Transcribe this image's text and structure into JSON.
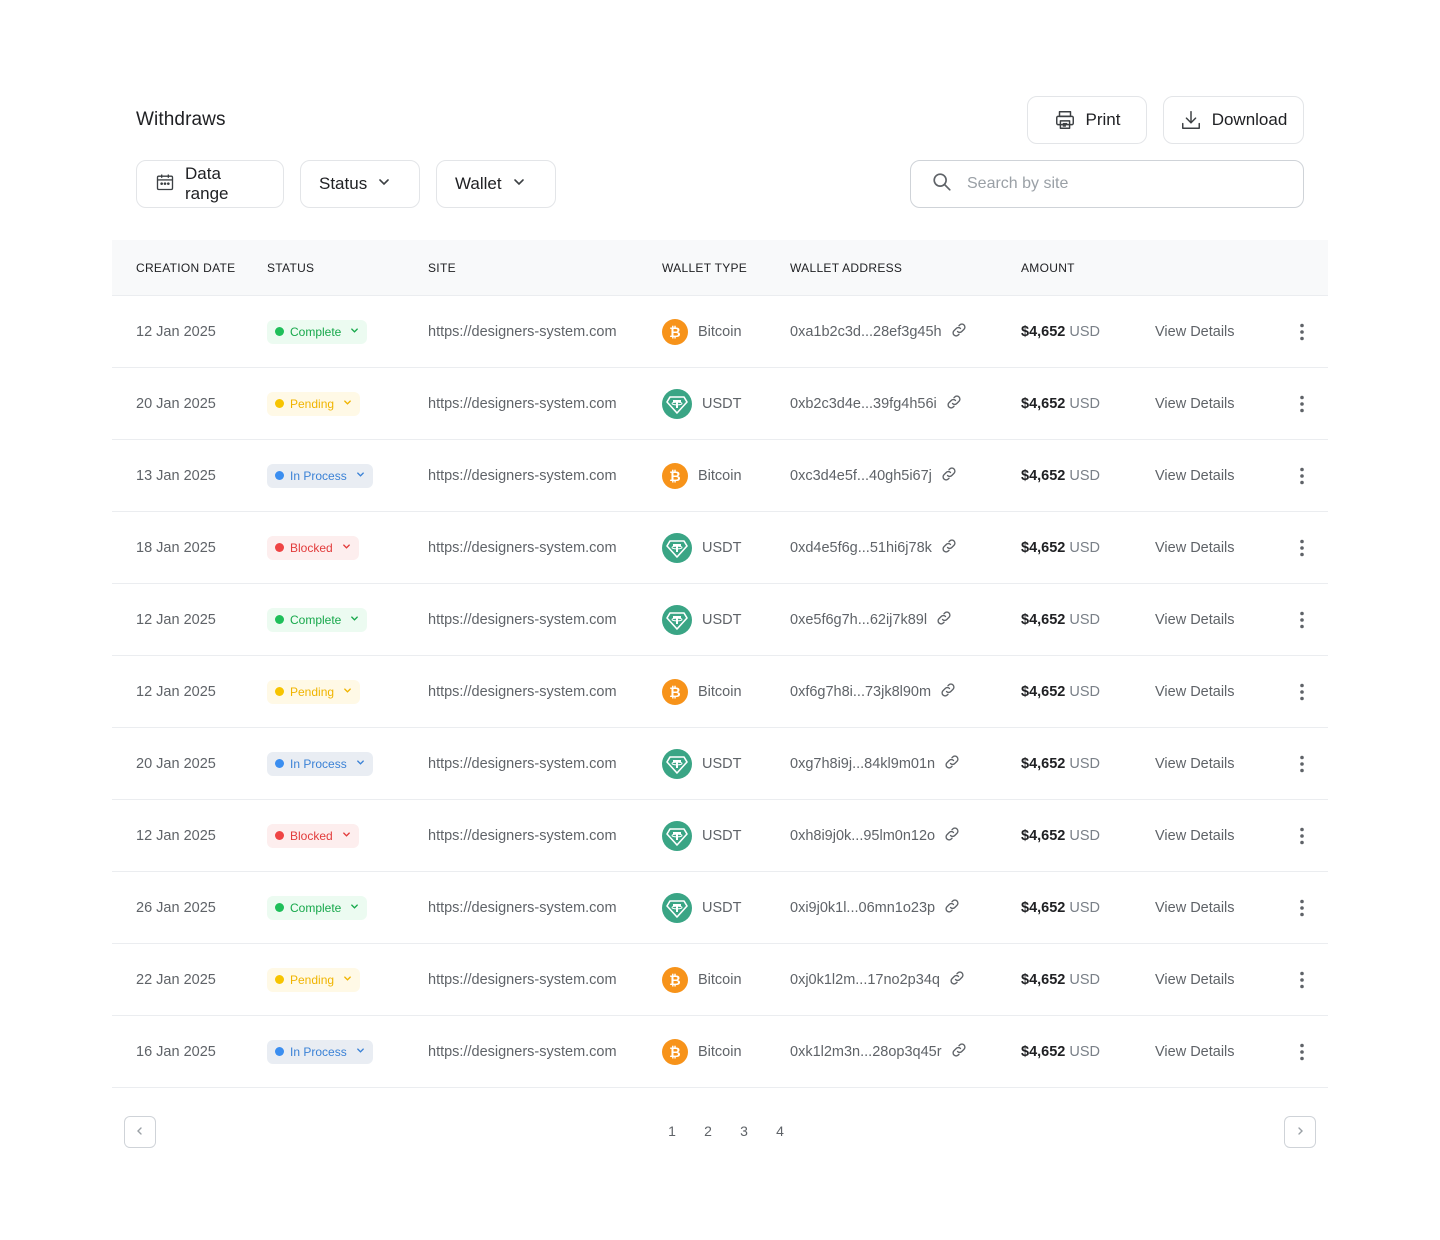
{
  "header": {
    "title": "Withdraws",
    "print_label": "Print",
    "download_label": "Download"
  },
  "filters": {
    "date_label": "Data range",
    "status_label": "Status",
    "wallet_label": "Wallet"
  },
  "search": {
    "placeholder": "Search by site",
    "value": ""
  },
  "columns": {
    "date": "CREATION DATE",
    "status": "STATUS",
    "site": "SITE",
    "wallet_type": "WALLET TYPE",
    "wallet_address": "WALLET ADDRESS",
    "amount": "AMOUNT"
  },
  "rows": [
    {
      "date": "12 Jan 2025",
      "status": "Complete",
      "site": "https://designers-system.com",
      "wallet": "Bitcoin",
      "address": "0xa1b2c3d...28ef3g45h",
      "amount": "$4,652",
      "currency": "USD",
      "action": "View Details"
    },
    {
      "date": "20 Jan 2025",
      "status": "Pending",
      "site": "https://designers-system.com",
      "wallet": "USDT",
      "address": "0xb2c3d4e...39fg4h56i",
      "amount": "$4,652",
      "currency": "USD",
      "action": "View Details"
    },
    {
      "date": "13 Jan 2025",
      "status": "In Process",
      "site": "https://designers-system.com",
      "wallet": "Bitcoin",
      "address": "0xc3d4e5f...40gh5i67j",
      "amount": "$4,652",
      "currency": "USD",
      "action": "View Details"
    },
    {
      "date": "18 Jan 2025",
      "status": "Blocked",
      "site": "https://designers-system.com",
      "wallet": "USDT",
      "address": "0xd4e5f6g...51hi6j78k",
      "amount": "$4,652",
      "currency": "USD",
      "action": "View Details"
    },
    {
      "date": "12 Jan 2025",
      "status": "Complete",
      "site": "https://designers-system.com",
      "wallet": "USDT",
      "address": "0xe5f6g7h...62ij7k89l",
      "amount": "$4,652",
      "currency": "USD",
      "action": "View Details"
    },
    {
      "date": "12 Jan 2025",
      "status": "Pending",
      "site": "https://designers-system.com",
      "wallet": "Bitcoin",
      "address": "0xf6g7h8i...73jk8l90m",
      "amount": "$4,652",
      "currency": "USD",
      "action": "View Details"
    },
    {
      "date": "20 Jan 2025",
      "status": "In Process",
      "site": "https://designers-system.com",
      "wallet": "USDT",
      "address": "0xg7h8i9j...84kl9m01n",
      "amount": "$4,652",
      "currency": "USD",
      "action": "View Details"
    },
    {
      "date": "12 Jan 2025",
      "status": "Blocked",
      "site": "https://designers-system.com",
      "wallet": "USDT",
      "address": "0xh8i9j0k...95lm0n12o",
      "amount": "$4,652",
      "currency": "USD",
      "action": "View Details"
    },
    {
      "date": "26 Jan 2025",
      "status": "Complete",
      "site": "https://designers-system.com",
      "wallet": "USDT",
      "address": "0xi9j0k1l...06mn1o23p",
      "amount": "$4,652",
      "currency": "USD",
      "action": "View Details"
    },
    {
      "date": "22 Jan 2025",
      "status": "Pending",
      "site": "https://designers-system.com",
      "wallet": "Bitcoin",
      "address": "0xj0k1l2m...17no2p34q",
      "amount": "$4,652",
      "currency": "USD",
      "action": "View Details"
    },
    {
      "date": "16 Jan 2025",
      "status": "In Process",
      "site": "https://designers-system.com",
      "wallet": "Bitcoin",
      "address": "0xk1l2m3n...28op3q45r",
      "amount": "$4,652",
      "currency": "USD",
      "action": "View Details"
    }
  ],
  "pagination": {
    "pages": [
      "1",
      "2",
      "3",
      "4"
    ],
    "prev_icon": "chevron-left-icon",
    "next_icon": "chevron-right-icon"
  },
  "icons": {
    "print": "printer-icon",
    "download": "download-icon",
    "calendar": "calendar-icon",
    "search": "search-icon",
    "link": "link-icon",
    "more": "kebab-menu-icon",
    "bitcoin": "bitcoin-icon",
    "usdt": "tether-icon"
  },
  "colors": {
    "complete": "#1fbf5a",
    "pending": "#f7c400",
    "in_process": "#3b8ef0",
    "blocked": "#ef4444",
    "bitcoin": "#f7931a",
    "usdt": "#3aa585"
  }
}
